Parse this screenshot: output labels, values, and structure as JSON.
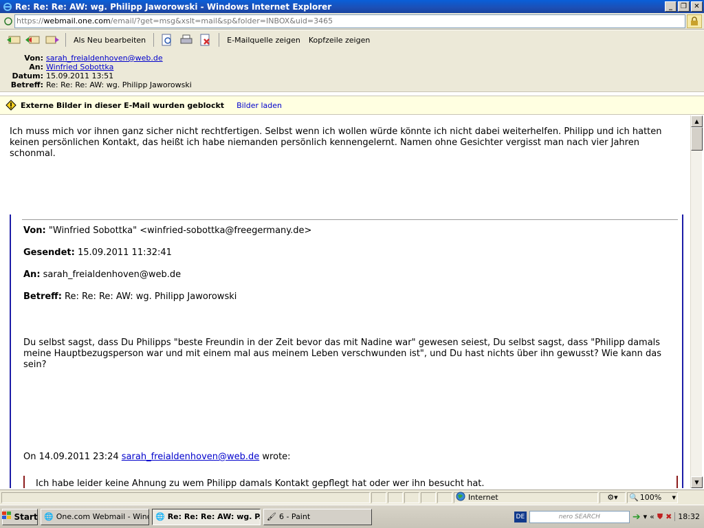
{
  "window": {
    "title": "Re: Re: Re: AW: wg. Philipp Jaworowski - Windows Internet Explorer",
    "controls": [
      "_",
      "❐",
      "✕"
    ]
  },
  "address": {
    "url_prefix": "https://",
    "url_domain": "webmail.one.com",
    "url_path": "/email/?get=msg&xslt=mail&sp&folder=INBOX&uid=3465"
  },
  "toolbar": {
    "mark_new_label": "Als Neu bearbeiten",
    "source_label": "E-Mailquelle zeigen",
    "headers_label": "Kopfzeile zeigen"
  },
  "headers": {
    "from_label": "Von:",
    "from_value": "sarah_freialdenhoven@web.de",
    "to_label": "An:",
    "to_value": "Winfried Sobottka",
    "date_label": "Datum:",
    "date_value": "15.09.2011 13:51",
    "subject_label": "Betreff:",
    "subject_value": "Re: Re: Re: AW: wg. Philipp Jaworowski"
  },
  "blocked": {
    "message": "Externe Bilder in dieser E-Mail wurden geblockt",
    "link": "Bilder laden"
  },
  "body": {
    "intro": "Ich muss mich vor ihnen ganz sicher nicht rechtfertigen. Selbst wenn ich wollen würde könnte ich nicht dabei weiterhelfen. Philipp und ich hatten keinen persönlichen Kontakt, das heißt ich habe niemanden persönlich kennengelernt. Namen ohne Gesichter vergisst man nach vier Jahren schonmal.",
    "quote": {
      "from_label": "Von:",
      "from_value": "\"Winfried Sobottka\" <winfried-sobottka@freegermany.de>",
      "sent_label": "Gesendet:",
      "sent_value": "15.09.2011 11:32:41",
      "to_label": "An:",
      "to_value": "sarah_freialdenhoven@web.de",
      "subject_label": "Betreff:",
      "subject_value": "Re: Re: Re: AW: wg. Philipp Jaworowski",
      "text": "Du selbst sagst, dass Du Philipps \"beste Freundin in der Zeit bevor das mit Nadine war\" gewesen seiest, Du selbst sagst, dass \"Philipp damals meine Hauptbezugsperson war und mit einem mal aus meinem Leben verschwunden ist\", und Du hast nichts über ihn gewusst? Wie kann das sein?",
      "wrote_prefix": "On 14.09.2011 23:24",
      "wrote_email": "sarah_freialdenhoven@web.de",
      "wrote_suffix": "wrote:",
      "inner_text": "Ich habe leider keine Ahnung zu wem Philipp damals Kontakt gepflegt hat oder wer ihn besucht hat."
    }
  },
  "status": {
    "zone": "Internet",
    "zoom": "100%"
  },
  "taskbar": {
    "start": "Start",
    "tasks": [
      "One.com Webmail - Wind...",
      "Re: Re: Re: AW: wg. P...",
      "6 - Paint"
    ],
    "lang": "DE",
    "search_placeholder": "nero SEARCH",
    "clock": "18:32"
  },
  "colors": {
    "titlebar": "#0a5fd8",
    "quote_border": "#1a1aa6",
    "inner_quote_border": "#8b1a1a",
    "link": "#0000cc"
  }
}
